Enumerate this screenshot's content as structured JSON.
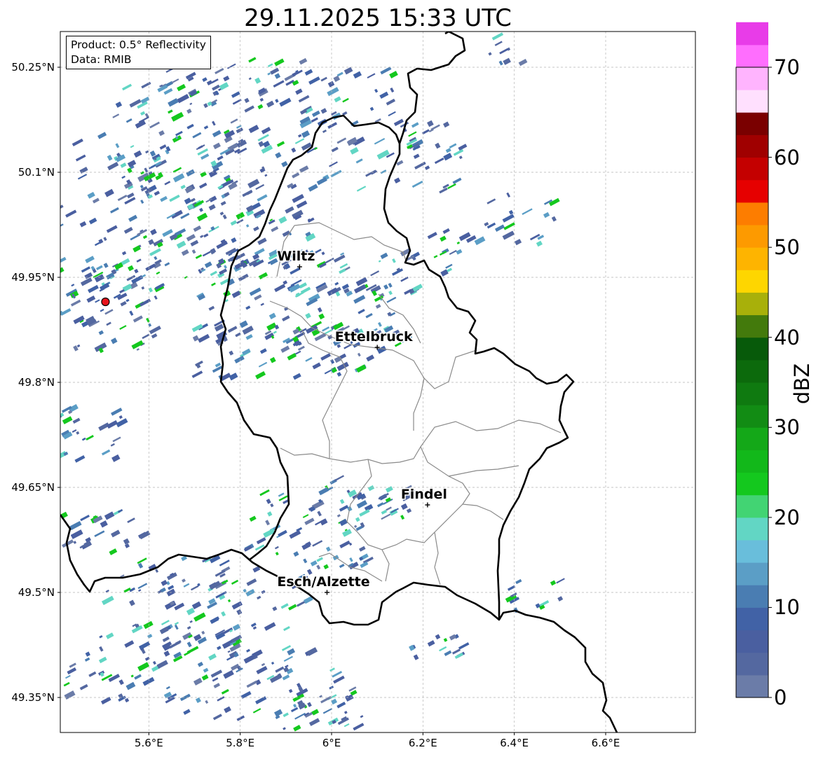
{
  "title": "29.11.2025 15:33 UTC",
  "info": {
    "product": "Product: 0.5° Reflectivity",
    "data_source": "Data: RMIB"
  },
  "axes": {
    "lat_labels": [
      "50.25°N",
      "50.1°N",
      "49.95°N",
      "49.8°N",
      "49.65°N",
      "49.5°N",
      "49.35°N"
    ],
    "lon_labels": [
      "5.6°E",
      "5.8°E",
      "6°E",
      "6.2°E",
      "6.4°E",
      "6.6°E"
    ],
    "grid": true
  },
  "cities": [
    {
      "name": "Wiltz",
      "lon": 5.93,
      "lat": 49.965
    },
    {
      "name": "Ettelbruck",
      "lon": 6.1,
      "lat": 49.85
    },
    {
      "name": "Findel",
      "lon": 6.21,
      "lat": 49.625
    },
    {
      "name": "Esch/Alzette",
      "lon": 5.99,
      "lat": 49.5
    }
  ],
  "radar_site": {
    "lon": 5.505,
    "lat": 49.915,
    "color": "#e8141c"
  },
  "colorbar": {
    "title": "dBZ",
    "tick_labels": [
      "0",
      "10",
      "20",
      "30",
      "40",
      "50",
      "60",
      "70"
    ],
    "min": 0,
    "max": 70,
    "step": 2.5,
    "colors": [
      "#6b7ca8",
      "#5468a0",
      "#4a5fa0",
      "#4162a6",
      "#4a7db2",
      "#5b9ec6",
      "#69bedb",
      "#62d6c4",
      "#42d473",
      "#14c81e",
      "#12b81a",
      "#14a818",
      "#128c14",
      "#0f7a10",
      "#0c6a0c",
      "#075a0a",
      "#437a0c",
      "#a8b00a",
      "#fed600",
      "#feb400",
      "#fd9a00",
      "#fd7d00",
      "#e60000",
      "#c40000",
      "#a00000",
      "#7a0000",
      "#ffe0fe",
      "#ffb4fe",
      "#ff6efe",
      "#e83ce8"
    ]
  },
  "colors": {
    "border": "#000000",
    "canton": "#8a8a8a",
    "grid": "#b4b4b4"
  }
}
